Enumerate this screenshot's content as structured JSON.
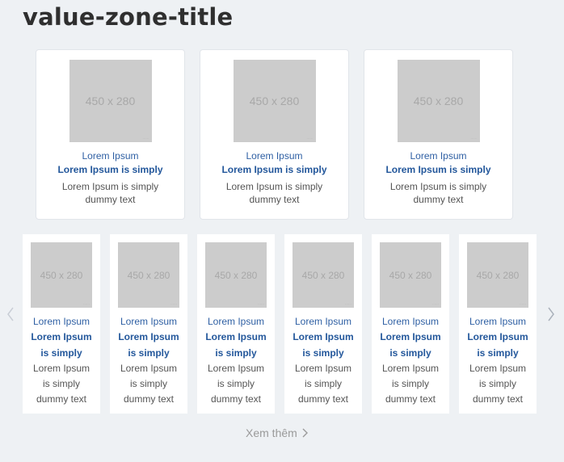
{
  "zone": {
    "title": "value-zone-title",
    "more_label": "Xem thêm"
  },
  "featured": [
    {
      "image_text": "450 x 280",
      "category": "Lorem Ipsum",
      "headline": "Lorem Ipsum is simply",
      "description": "Lorem Ipsum is simply dummy text"
    },
    {
      "image_text": "450 x 280",
      "category": "Lorem Ipsum",
      "headline": "Lorem Ipsum is simply",
      "description": "Lorem Ipsum is simply dummy text"
    },
    {
      "image_text": "450 x 280",
      "category": "Lorem Ipsum",
      "headline": "Lorem Ipsum is simply",
      "description": "Lorem Ipsum is simply dummy text"
    }
  ],
  "carousel": [
    {
      "image_text": "450 x 280",
      "category": "Lorem Ipsum",
      "headline": "Lorem Ipsum is simply",
      "description": "Lorem Ipsum is simply dummy text"
    },
    {
      "image_text": "450 x 280",
      "category": "Lorem Ipsum",
      "headline": "Lorem Ipsum is simply",
      "description": "Lorem Ipsum is simply dummy text"
    },
    {
      "image_text": "450 x 280",
      "category": "Lorem Ipsum",
      "headline": "Lorem Ipsum is simply",
      "description": "Lorem Ipsum is simply dummy text"
    },
    {
      "image_text": "450 x 280",
      "category": "Lorem Ipsum",
      "headline": "Lorem Ipsum is simply",
      "description": "Lorem Ipsum is simply dummy text"
    },
    {
      "image_text": "450 x 280",
      "category": "Lorem Ipsum",
      "headline": "Lorem Ipsum is simply",
      "description": "Lorem Ipsum is simply dummy text"
    },
    {
      "image_text": "450 x 280",
      "category": "Lorem Ipsum",
      "headline": "Lorem Ipsum is simply",
      "description": "Lorem Ipsum is simply dummy text"
    }
  ],
  "icons": {
    "prev": "chevron-left-icon",
    "next": "chevron-right-icon",
    "more": "chevron-right-icon"
  },
  "colors": {
    "background": "#eef1f4",
    "link_blue": "#2e5fa3",
    "placeholder_gray": "#cccccc"
  }
}
